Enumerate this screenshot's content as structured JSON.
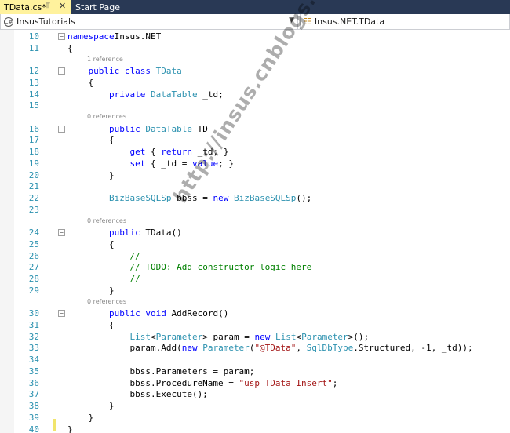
{
  "tabs": [
    {
      "label": "TData.cs*",
      "active": true
    },
    {
      "label": "Start Page",
      "active": false
    }
  ],
  "nav": {
    "project": "InsusTutorials",
    "type": "Insus.NET.TData"
  },
  "colors": {
    "tab_active": "#fff29d",
    "tab_bar": "#293955",
    "keyword": "#0000ff",
    "type": "#2b91af",
    "string": "#a31515",
    "comment": "#008000",
    "line_number": "#2b91af"
  },
  "lines": [
    {
      "n": "10",
      "fold": "-",
      "tokens": [
        [
          "kw",
          "namespace"
        ],
        [
          "",
          "Insus.NET"
        ]
      ]
    },
    {
      "n": "11",
      "tokens": [
        [
          "",
          "{"
        ]
      ]
    },
    {
      "lens": "1 reference"
    },
    {
      "n": "12",
      "fold": "-",
      "tokens": [
        [
          "",
          "    "
        ],
        [
          "kw",
          "public"
        ],
        [
          "",
          " "
        ],
        [
          "kw",
          "class"
        ],
        [
          "",
          " "
        ],
        [
          "ty",
          "TData"
        ]
      ]
    },
    {
      "n": "13",
      "tokens": [
        [
          "",
          "    {"
        ]
      ]
    },
    {
      "n": "14",
      "tokens": [
        [
          "",
          "        "
        ],
        [
          "kw",
          "private"
        ],
        [
          "",
          " "
        ],
        [
          "ty",
          "DataTable"
        ],
        [
          "",
          " _td;"
        ]
      ]
    },
    {
      "n": "15",
      "tokens": []
    },
    {
      "lens": "0 references"
    },
    {
      "n": "16",
      "fold": "-",
      "tokens": [
        [
          "",
          "        "
        ],
        [
          "kw",
          "public"
        ],
        [
          "",
          " "
        ],
        [
          "ty",
          "DataTable"
        ],
        [
          "",
          " TD"
        ]
      ]
    },
    {
      "n": "17",
      "tokens": [
        [
          "",
          "        {"
        ]
      ]
    },
    {
      "n": "18",
      "tokens": [
        [
          "",
          "            "
        ],
        [
          "kw",
          "get"
        ],
        [
          "",
          " { "
        ],
        [
          "kw",
          "return"
        ],
        [
          "",
          " _td; }"
        ]
      ]
    },
    {
      "n": "19",
      "tokens": [
        [
          "",
          "            "
        ],
        [
          "kw",
          "set"
        ],
        [
          "",
          " { _td = "
        ],
        [
          "kw",
          "value"
        ],
        [
          "",
          "; }"
        ]
      ]
    },
    {
      "n": "20",
      "tokens": [
        [
          "",
          "        }"
        ]
      ]
    },
    {
      "n": "21",
      "tokens": []
    },
    {
      "n": "22",
      "tokens": [
        [
          "",
          "        "
        ],
        [
          "ty",
          "BizBaseSQLSp"
        ],
        [
          "",
          " bbss = "
        ],
        [
          "kw",
          "new"
        ],
        [
          "",
          " "
        ],
        [
          "ty",
          "BizBaseSQLSp"
        ],
        [
          "",
          "();"
        ]
      ]
    },
    {
      "n": "23",
      "tokens": []
    },
    {
      "lens": "0 references"
    },
    {
      "n": "24",
      "fold": "-",
      "tokens": [
        [
          "",
          "        "
        ],
        [
          "kw",
          "public"
        ],
        [
          "",
          " TData()"
        ]
      ]
    },
    {
      "n": "25",
      "tokens": [
        [
          "",
          "        {"
        ]
      ]
    },
    {
      "n": "26",
      "tokens": [
        [
          "",
          "            "
        ],
        [
          "cm",
          "//"
        ]
      ]
    },
    {
      "n": "27",
      "tokens": [
        [
          "",
          "            "
        ],
        [
          "cm",
          "// TODO: Add constructor logic here"
        ]
      ]
    },
    {
      "n": "28",
      "tokens": [
        [
          "",
          "            "
        ],
        [
          "cm",
          "//"
        ]
      ]
    },
    {
      "n": "29",
      "tokens": [
        [
          "",
          "        }"
        ]
      ]
    },
    {
      "lens": "0 references"
    },
    {
      "n": "30",
      "fold": "-",
      "tokens": [
        [
          "",
          "        "
        ],
        [
          "kw",
          "public"
        ],
        [
          "",
          " "
        ],
        [
          "kw",
          "void"
        ],
        [
          "",
          " AddRecord()"
        ]
      ]
    },
    {
      "n": "31",
      "tokens": [
        [
          "",
          "        {"
        ]
      ]
    },
    {
      "n": "32",
      "tokens": [
        [
          "",
          "            "
        ],
        [
          "ty",
          "List"
        ],
        [
          "",
          "<"
        ],
        [
          "ty",
          "Parameter"
        ],
        [
          "",
          "> param = "
        ],
        [
          "kw",
          "new"
        ],
        [
          "",
          " "
        ],
        [
          "ty",
          "List"
        ],
        [
          "",
          "<"
        ],
        [
          "ty",
          "Parameter"
        ],
        [
          "",
          ">();"
        ]
      ]
    },
    {
      "n": "33",
      "tokens": [
        [
          "",
          "            param.Add("
        ],
        [
          "kw",
          "new"
        ],
        [
          "",
          " "
        ],
        [
          "ty",
          "Parameter"
        ],
        [
          "",
          "("
        ],
        [
          "st",
          "\"@TData\""
        ],
        [
          "",
          ", "
        ],
        [
          "ty",
          "SqlDbType"
        ],
        [
          "",
          ".Structured, -1, _td));"
        ]
      ]
    },
    {
      "n": "34",
      "tokens": []
    },
    {
      "n": "35",
      "tokens": [
        [
          "",
          "            bbss.Parameters = param;"
        ]
      ]
    },
    {
      "n": "36",
      "tokens": [
        [
          "",
          "            bbss.ProcedureName = "
        ],
        [
          "st",
          "\"usp_TData_Insert\""
        ],
        [
          "",
          ";"
        ]
      ]
    },
    {
      "n": "37",
      "tokens": [
        [
          "",
          "            bbss.Execute();"
        ]
      ]
    },
    {
      "n": "38",
      "tokens": [
        [
          "",
          "        }"
        ]
      ]
    },
    {
      "n": "39",
      "tokens": [
        [
          "",
          "    }"
        ]
      ]
    },
    {
      "n": "40",
      "tokens": [
        [
          "",
          "}"
        ]
      ]
    }
  ],
  "watermark": "http://insus.cnblogs.com"
}
